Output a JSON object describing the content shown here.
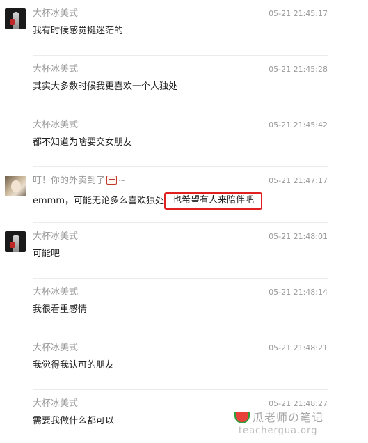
{
  "messages": [
    {
      "name": "大杯冰美式",
      "time": "05-21 21:45:17",
      "text": "我有时候感觉挺迷茫的",
      "avatar": "dark"
    },
    {
      "name": "大杯冰美式",
      "time": "05-21 21:45:28",
      "text": "其实大多数时候我更喜欢一个人独处"
    },
    {
      "name": "大杯冰美式",
      "time": "05-21 21:45:42",
      "text": "都不知道为啥要交女朋友"
    },
    {
      "name_before": "叮！你的外卖到了",
      "name_emoji": "takeout-box-emoji",
      "name_after": "~",
      "time": "05-21 21:47:17",
      "text": "emmm，可能无论多么喜欢独处",
      "highlighted": "也希望有人来陪伴吧",
      "avatar": "photo"
    },
    {
      "name": "大杯冰美式",
      "time": "05-21 21:48:01",
      "text": "可能吧",
      "avatar": "dark"
    },
    {
      "name": "大杯冰美式",
      "time": "05-21 21:48:14",
      "text": "我很看重感情"
    },
    {
      "name": "大杯冰美式",
      "time": "05-21 21:48:21",
      "text": "我觉得我认可的朋友"
    },
    {
      "name": "大杯冰美式",
      "time": "05-21 21:48:27",
      "text": "需要我做什么都可以"
    }
  ],
  "watermark": {
    "icon": "watermelon-icon",
    "title": "瓜老师の笔记",
    "url": "teachergua.org"
  },
  "colors": {
    "name": "#9a9a9a",
    "time": "#9a9a9a",
    "text": "#222222",
    "highlight_border": "#e02020"
  }
}
